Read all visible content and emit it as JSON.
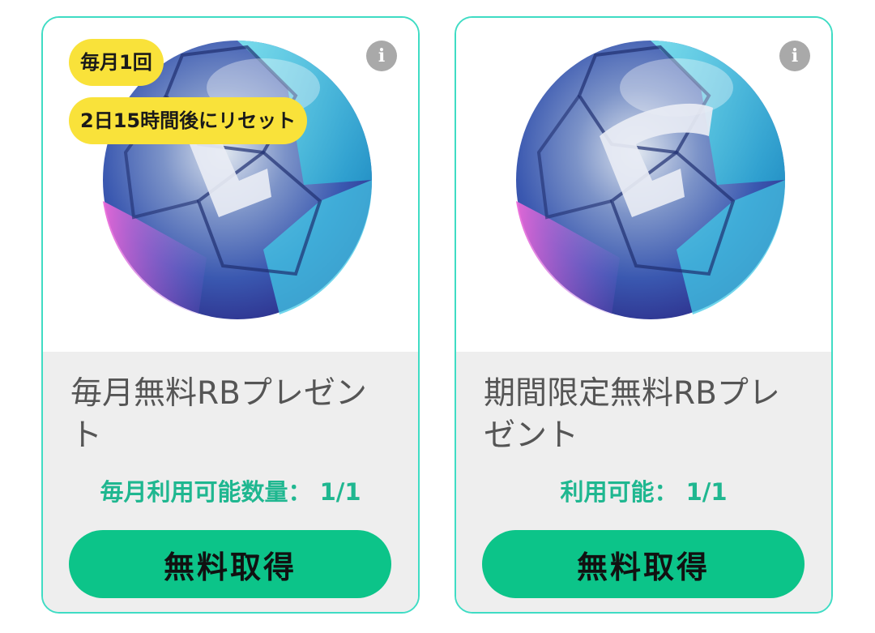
{
  "cards": [
    {
      "badges": [
        "毎月1回",
        "2日15時間後にリセット"
      ],
      "title": "毎月無料RBプレゼント",
      "availability": "毎月利用可能数量： 1/1",
      "button": "無料取得",
      "icon": "soccer-ball-icon"
    },
    {
      "badges": [],
      "title": "期間限定無料RBプレゼント",
      "availability": "利用可能： 1/1",
      "button": "無料取得",
      "icon": "soccer-ball-icon"
    }
  ],
  "info_icon": "i",
  "colors": {
    "card_border": "#3fdcc4",
    "badge": "#f9e23a",
    "button": "#0cc489",
    "availability_text": "#1fb790",
    "info_icon": "#a9a9a9"
  }
}
